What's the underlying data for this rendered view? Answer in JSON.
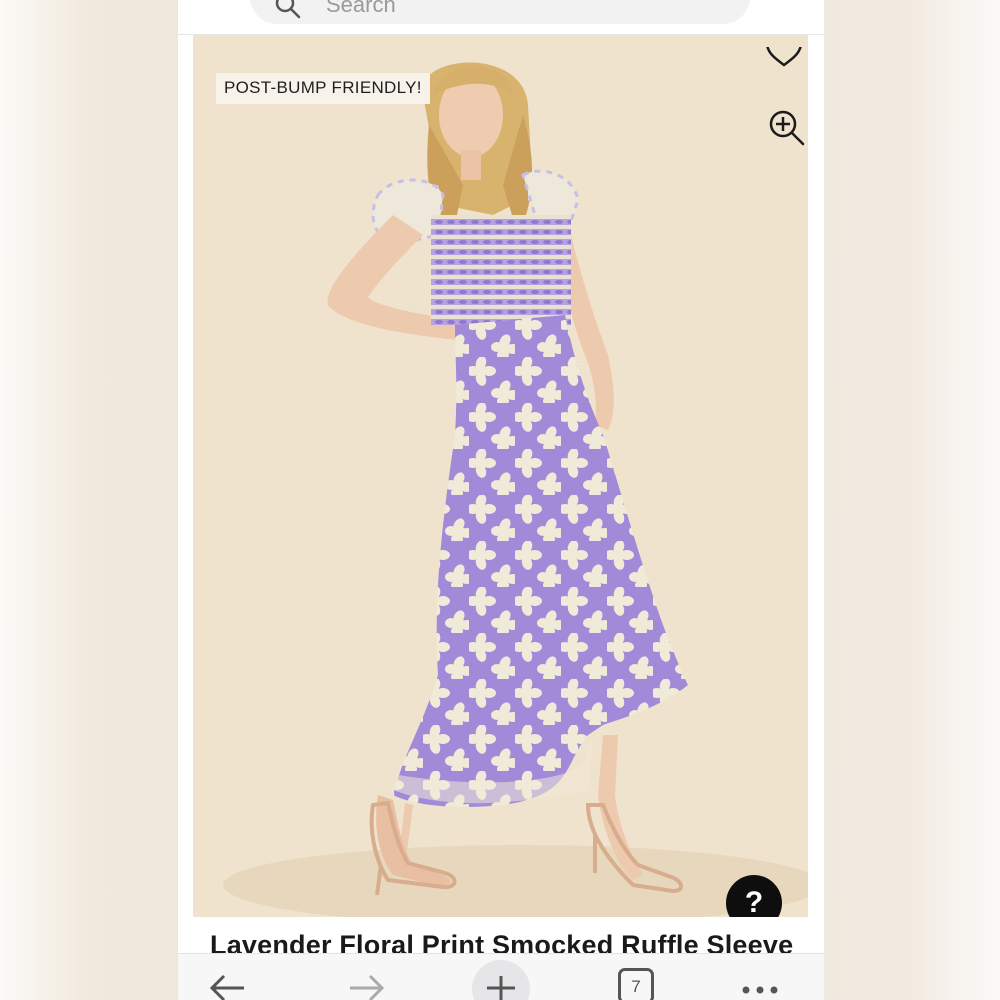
{
  "search": {
    "placeholder": "Search"
  },
  "product": {
    "badge": "POST-BUMP FRIENDLY!",
    "title": "Lavender Floral Print Smocked Ruffle Sleeve"
  },
  "help": {
    "label": "?"
  },
  "browser_bar": {
    "tab_count": "7"
  },
  "icons": {
    "search": "search-icon",
    "heart": "heart-icon",
    "zoom": "zoom-in-icon",
    "back": "back-arrow-icon",
    "forward": "forward-arrow-icon",
    "new_tab": "plus-icon",
    "more": "more-icon"
  },
  "colors": {
    "photo_background": "#eee2cc",
    "dress_base": "#f0ead9",
    "dress_print": "#a28ad8",
    "help_button": "#0e0e0e"
  }
}
